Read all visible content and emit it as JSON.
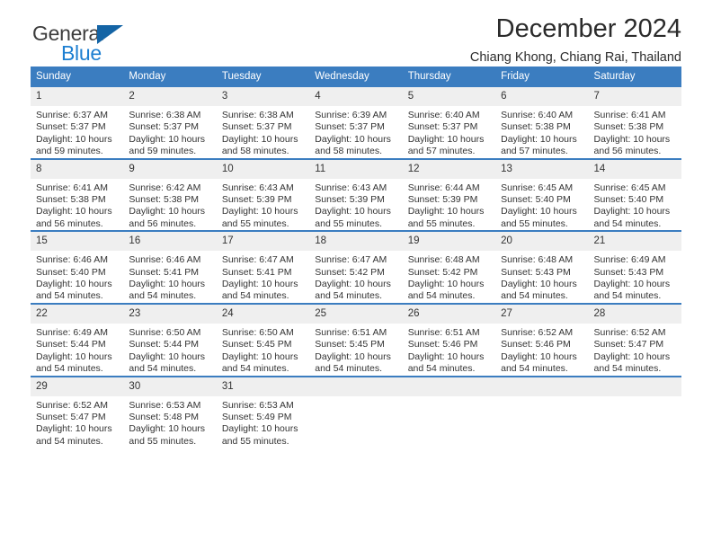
{
  "brand": {
    "name_part1": "General",
    "name_part2": "Blue"
  },
  "header": {
    "title": "December 2024",
    "subtitle": "Chiang Khong, Chiang Rai, Thailand"
  },
  "colors": {
    "header_blue": "#3b7dc0",
    "daynum_gray": "#efefef",
    "brand_blue": "#1d7fd1",
    "text": "#333333"
  },
  "weekdays": [
    "Sunday",
    "Monday",
    "Tuesday",
    "Wednesday",
    "Thursday",
    "Friday",
    "Saturday"
  ],
  "weeks": [
    [
      {
        "day": "1",
        "sunrise": "Sunrise: 6:37 AM",
        "sunset": "Sunset: 5:37 PM",
        "daylight": "Daylight: 10 hours and 59 minutes."
      },
      {
        "day": "2",
        "sunrise": "Sunrise: 6:38 AM",
        "sunset": "Sunset: 5:37 PM",
        "daylight": "Daylight: 10 hours and 59 minutes."
      },
      {
        "day": "3",
        "sunrise": "Sunrise: 6:38 AM",
        "sunset": "Sunset: 5:37 PM",
        "daylight": "Daylight: 10 hours and 58 minutes."
      },
      {
        "day": "4",
        "sunrise": "Sunrise: 6:39 AM",
        "sunset": "Sunset: 5:37 PM",
        "daylight": "Daylight: 10 hours and 58 minutes."
      },
      {
        "day": "5",
        "sunrise": "Sunrise: 6:40 AM",
        "sunset": "Sunset: 5:37 PM",
        "daylight": "Daylight: 10 hours and 57 minutes."
      },
      {
        "day": "6",
        "sunrise": "Sunrise: 6:40 AM",
        "sunset": "Sunset: 5:38 PM",
        "daylight": "Daylight: 10 hours and 57 minutes."
      },
      {
        "day": "7",
        "sunrise": "Sunrise: 6:41 AM",
        "sunset": "Sunset: 5:38 PM",
        "daylight": "Daylight: 10 hours and 56 minutes."
      }
    ],
    [
      {
        "day": "8",
        "sunrise": "Sunrise: 6:41 AM",
        "sunset": "Sunset: 5:38 PM",
        "daylight": "Daylight: 10 hours and 56 minutes."
      },
      {
        "day": "9",
        "sunrise": "Sunrise: 6:42 AM",
        "sunset": "Sunset: 5:38 PM",
        "daylight": "Daylight: 10 hours and 56 minutes."
      },
      {
        "day": "10",
        "sunrise": "Sunrise: 6:43 AM",
        "sunset": "Sunset: 5:39 PM",
        "daylight": "Daylight: 10 hours and 55 minutes."
      },
      {
        "day": "11",
        "sunrise": "Sunrise: 6:43 AM",
        "sunset": "Sunset: 5:39 PM",
        "daylight": "Daylight: 10 hours and 55 minutes."
      },
      {
        "day": "12",
        "sunrise": "Sunrise: 6:44 AM",
        "sunset": "Sunset: 5:39 PM",
        "daylight": "Daylight: 10 hours and 55 minutes."
      },
      {
        "day": "13",
        "sunrise": "Sunrise: 6:45 AM",
        "sunset": "Sunset: 5:40 PM",
        "daylight": "Daylight: 10 hours and 55 minutes."
      },
      {
        "day": "14",
        "sunrise": "Sunrise: 6:45 AM",
        "sunset": "Sunset: 5:40 PM",
        "daylight": "Daylight: 10 hours and 54 minutes."
      }
    ],
    [
      {
        "day": "15",
        "sunrise": "Sunrise: 6:46 AM",
        "sunset": "Sunset: 5:40 PM",
        "daylight": "Daylight: 10 hours and 54 minutes."
      },
      {
        "day": "16",
        "sunrise": "Sunrise: 6:46 AM",
        "sunset": "Sunset: 5:41 PM",
        "daylight": "Daylight: 10 hours and 54 minutes."
      },
      {
        "day": "17",
        "sunrise": "Sunrise: 6:47 AM",
        "sunset": "Sunset: 5:41 PM",
        "daylight": "Daylight: 10 hours and 54 minutes."
      },
      {
        "day": "18",
        "sunrise": "Sunrise: 6:47 AM",
        "sunset": "Sunset: 5:42 PM",
        "daylight": "Daylight: 10 hours and 54 minutes."
      },
      {
        "day": "19",
        "sunrise": "Sunrise: 6:48 AM",
        "sunset": "Sunset: 5:42 PM",
        "daylight": "Daylight: 10 hours and 54 minutes."
      },
      {
        "day": "20",
        "sunrise": "Sunrise: 6:48 AM",
        "sunset": "Sunset: 5:43 PM",
        "daylight": "Daylight: 10 hours and 54 minutes."
      },
      {
        "day": "21",
        "sunrise": "Sunrise: 6:49 AM",
        "sunset": "Sunset: 5:43 PM",
        "daylight": "Daylight: 10 hours and 54 minutes."
      }
    ],
    [
      {
        "day": "22",
        "sunrise": "Sunrise: 6:49 AM",
        "sunset": "Sunset: 5:44 PM",
        "daylight": "Daylight: 10 hours and 54 minutes."
      },
      {
        "day": "23",
        "sunrise": "Sunrise: 6:50 AM",
        "sunset": "Sunset: 5:44 PM",
        "daylight": "Daylight: 10 hours and 54 minutes."
      },
      {
        "day": "24",
        "sunrise": "Sunrise: 6:50 AM",
        "sunset": "Sunset: 5:45 PM",
        "daylight": "Daylight: 10 hours and 54 minutes."
      },
      {
        "day": "25",
        "sunrise": "Sunrise: 6:51 AM",
        "sunset": "Sunset: 5:45 PM",
        "daylight": "Daylight: 10 hours and 54 minutes."
      },
      {
        "day": "26",
        "sunrise": "Sunrise: 6:51 AM",
        "sunset": "Sunset: 5:46 PM",
        "daylight": "Daylight: 10 hours and 54 minutes."
      },
      {
        "day": "27",
        "sunrise": "Sunrise: 6:52 AM",
        "sunset": "Sunset: 5:46 PM",
        "daylight": "Daylight: 10 hours and 54 minutes."
      },
      {
        "day": "28",
        "sunrise": "Sunrise: 6:52 AM",
        "sunset": "Sunset: 5:47 PM",
        "daylight": "Daylight: 10 hours and 54 minutes."
      }
    ],
    [
      {
        "day": "29",
        "sunrise": "Sunrise: 6:52 AM",
        "sunset": "Sunset: 5:47 PM",
        "daylight": "Daylight: 10 hours and 54 minutes."
      },
      {
        "day": "30",
        "sunrise": "Sunrise: 6:53 AM",
        "sunset": "Sunset: 5:48 PM",
        "daylight": "Daylight: 10 hours and 55 minutes."
      },
      {
        "day": "31",
        "sunrise": "Sunrise: 6:53 AM",
        "sunset": "Sunset: 5:49 PM",
        "daylight": "Daylight: 10 hours and 55 minutes."
      },
      {
        "day": "",
        "sunrise": "",
        "sunset": "",
        "daylight": ""
      },
      {
        "day": "",
        "sunrise": "",
        "sunset": "",
        "daylight": ""
      },
      {
        "day": "",
        "sunrise": "",
        "sunset": "",
        "daylight": ""
      },
      {
        "day": "",
        "sunrise": "",
        "sunset": "",
        "daylight": ""
      }
    ]
  ]
}
